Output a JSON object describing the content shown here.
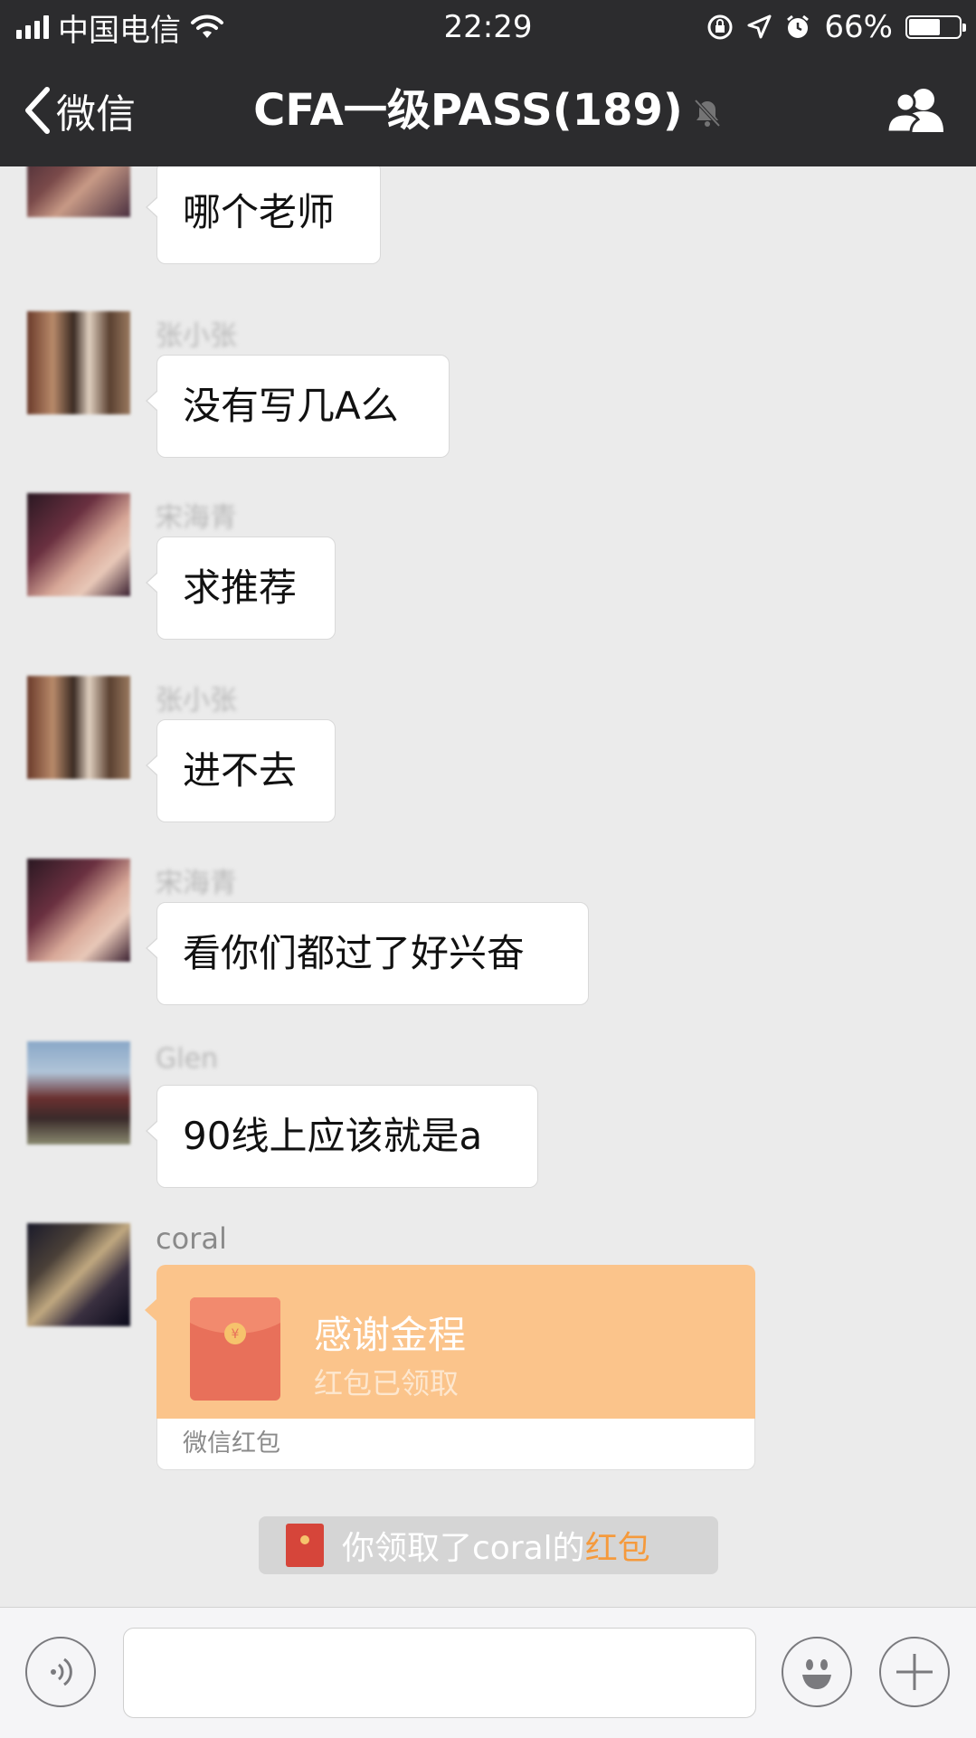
{
  "status_bar": {
    "carrier": "中国电信",
    "time": "22:29",
    "battery": "66%",
    "battery_level": 0.66
  },
  "nav": {
    "back_label": "微信",
    "title": "CFA一级PASS(189)"
  },
  "messages": [
    {
      "sender": "",
      "text": "哪个老师"
    },
    {
      "sender": "张小张",
      "text": "没有写几A么"
    },
    {
      "sender": "宋海青",
      "text": "求推荐"
    },
    {
      "sender": "张小张",
      "text": "进不去"
    },
    {
      "sender": "宋海青",
      "text": "看你们都过了好兴奋"
    },
    {
      "sender": "Glen",
      "text": "90线上应该就是a"
    },
    {
      "sender": "coral",
      "text": ""
    }
  ],
  "red_packet": {
    "title": "感谢金程",
    "status": "红包已领取",
    "footer": "微信红包"
  },
  "notice": {
    "prefix": "你领取了coral的",
    "link": "红包"
  },
  "colors": {
    "bar_bg": "#2c2c2e",
    "chat_bg": "#ebebeb",
    "red_packet": "#fbc48b",
    "accent": "#f59a3c"
  }
}
